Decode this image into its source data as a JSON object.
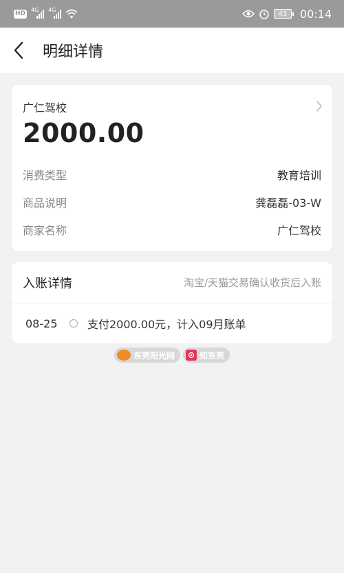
{
  "status_bar": {
    "hd": "HD",
    "net1": "4G",
    "net2": "4G",
    "battery": "43",
    "time": "00:14"
  },
  "nav": {
    "title": "明细详情"
  },
  "summary": {
    "merchant": "广仁驾校",
    "amount": "2000.00",
    "rows": [
      {
        "label": "消费类型",
        "value": "教育培训"
      },
      {
        "label": "商品说明",
        "value": "龚磊磊-03-W"
      },
      {
        "label": "商家名称",
        "value": "广仁驾校"
      }
    ]
  },
  "entry": {
    "title": "入账详情",
    "note": "淘宝/天猫交易确认收货后入账",
    "records": [
      {
        "date": "08-25",
        "desc": "支付2000.00元，计入09月账单"
      }
    ]
  },
  "watermark": {
    "left": "东莞阳光网",
    "right": "知东莞"
  },
  "colors": {
    "status_bar_bg": "#9a9a9a",
    "page_bg": "#f2f2f2",
    "card_bg": "#ffffff"
  }
}
